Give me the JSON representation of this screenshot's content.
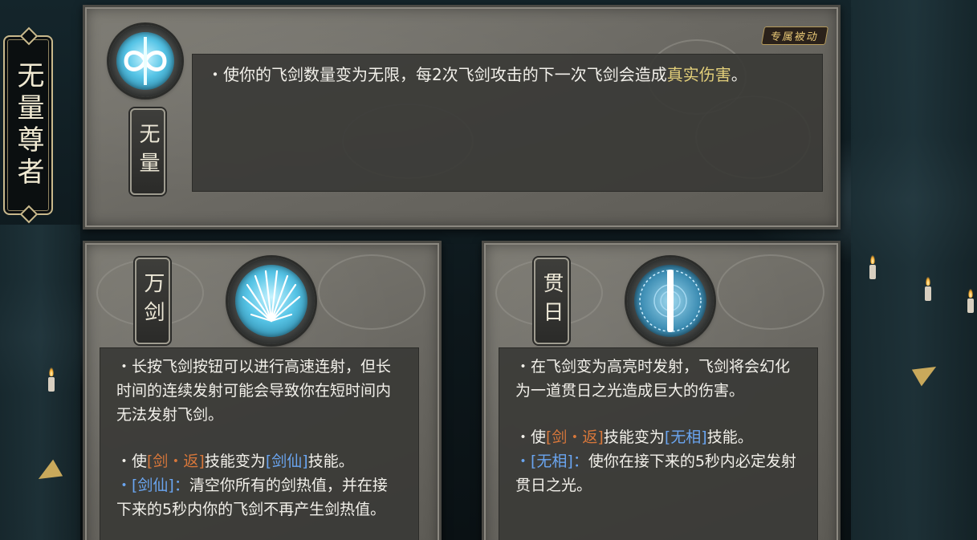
{
  "character": {
    "title": "无量尊者"
  },
  "main_skill": {
    "name": "无量",
    "icon": "infinity-sword-icon",
    "tag": "专属被动",
    "line1_prefix": "・使你的飞剑数量变为无限，每2次飞剑攻击的下一次飞剑会造成",
    "line1_highlight": "真实伤害",
    "line1_suffix": "。"
  },
  "skill_left": {
    "name": "万剑",
    "icon": "sword-fan-icon",
    "desc1": "・长按飞剑按钮可以进行高速连射，但长时间的连续发射可能会导致你在短时间内无法发射飞剑。",
    "desc2_prefix": "・使",
    "desc2_tag_a": "[剑・返]",
    "desc2_mid": "技能变为",
    "desc2_tag_b": "[剑仙]",
    "desc2_suffix": "技能。",
    "desc3_tag": "・[剑仙]：",
    "desc3_text": "清空你所有的剑热值，并在接下来的5秒内你的飞剑不再产生剑热值。"
  },
  "skill_right": {
    "name": "贯日",
    "icon": "sun-pierce-icon",
    "desc1": "・在飞剑变为高亮时发射，飞剑将会幻化为一道贯日之光造成巨大的伤害。",
    "desc2_prefix": "・使",
    "desc2_tag_a": "[剑・返]",
    "desc2_mid": "技能变为",
    "desc2_tag_b": "[无相]",
    "desc2_suffix": "技能。",
    "desc3_tag": "・[无相]：",
    "desc3_text": "使你在接下来的5秒内必定发射贯日之光。"
  },
  "colors": {
    "gold": "#e3cf7a",
    "orange": "#d8773a",
    "blue": "#6aa5f0",
    "icon_cyan": "#56c4e6"
  }
}
